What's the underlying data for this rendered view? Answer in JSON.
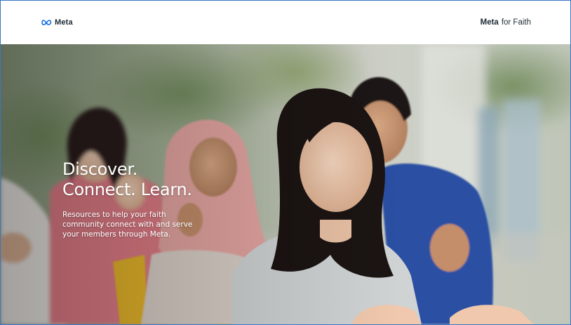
{
  "header": {
    "brand_text": "Meta",
    "product_strong": "Meta",
    "product_light": "for Faith"
  },
  "hero": {
    "headline_line1": "Discover.",
    "headline_line2": "Connect. Learn.",
    "subcopy": "Resources to help your faith community connect with and serve your members through Meta."
  },
  "colors": {
    "brand_blue": "#0668e1",
    "text_dark": "#1c2b33",
    "frame_border": "#3a76c4"
  },
  "icons": {
    "brand_logo": "meta-infinity-icon"
  }
}
